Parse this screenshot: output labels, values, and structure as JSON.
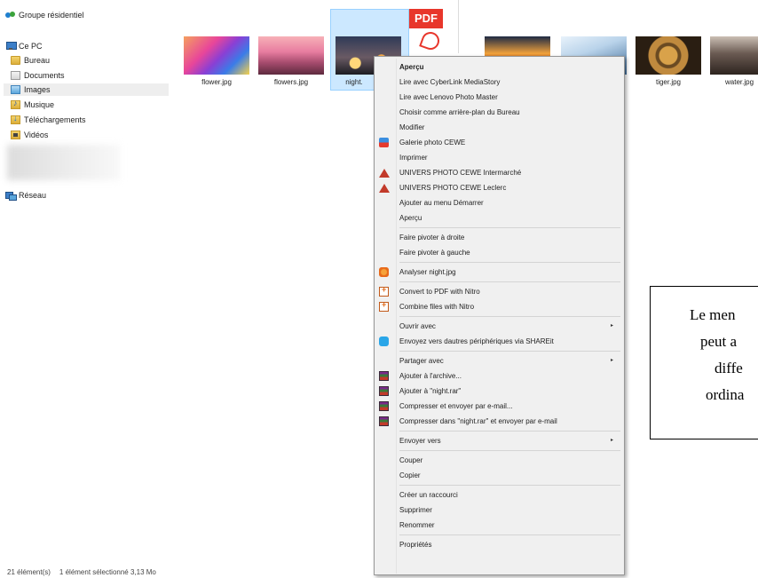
{
  "navigation": {
    "items": [
      {
        "label": "Groupe résidentiel",
        "icon": "homegroup-icon"
      },
      {
        "label": "Ce PC",
        "icon": "computer-icon"
      },
      {
        "label": "Bureau",
        "icon": "desktop-folder-icon"
      },
      {
        "label": "Documents",
        "icon": "documents-folder-icon"
      },
      {
        "label": "Images",
        "icon": "pictures-folder-icon",
        "selected": true
      },
      {
        "label": "Musique",
        "icon": "music-folder-icon"
      },
      {
        "label": "Téléchargements",
        "icon": "downloads-folder-icon"
      },
      {
        "label": "Vidéos",
        "icon": "videos-folder-icon"
      },
      {
        "label": "Réseau",
        "icon": "network-icon"
      }
    ]
  },
  "files": [
    {
      "name": "flower.jpg"
    },
    {
      "name": "flowers.jpg"
    },
    {
      "name": "night.",
      "selected": true
    },
    {
      "name": "PDF"
    },
    {
      "name": "tiger.jpg"
    },
    {
      "name": "water.jpg"
    }
  ],
  "context_menu": {
    "items": [
      "Aperçu",
      "Lire avec CyberLink MediaStory",
      "Lire avec Lenovo Photo Master",
      "Choisir comme arrière-plan du Bureau",
      "Modifier",
      "Galerie photo CEWE",
      "Imprimer",
      "UNIVERS PHOTO CEWE Intermarché",
      "UNIVERS PHOTO CEWE Leclerc",
      "Ajouter au menu Démarrer",
      "Aperçu",
      "Faire pivoter à droite",
      "Faire pivoter à gauche",
      "Analyser night.jpg",
      "Convert to PDF with Nitro",
      "Combine files with Nitro",
      "Ouvrir avec",
      "Envoyez vers dautres périphériques via SHAREit",
      "Partager avec",
      "Ajouter à l'archive...",
      "Ajouter à \"night.rar\"",
      "Compresser et envoyer par e-mail...",
      "Compresser dans \"night.rar\" et envoyer par e-mail",
      "Envoyer vers",
      "Couper",
      "Copier",
      "Créer un raccourci",
      "Supprimer",
      "Renommer",
      "Propriétés"
    ],
    "submenu_arrow": "▸"
  },
  "annotation": {
    "lines": [
      "Le men",
      "peut a",
      "diffe",
      "ordina"
    ]
  },
  "status_bar": {
    "count": "21 élément(s)",
    "selection": "1 élément sélectionné  3,13 Mo"
  },
  "colors": {
    "selection_bg": "#cce8ff",
    "selection_border": "#99d1ff",
    "menu_bg": "#f0f0f0"
  }
}
